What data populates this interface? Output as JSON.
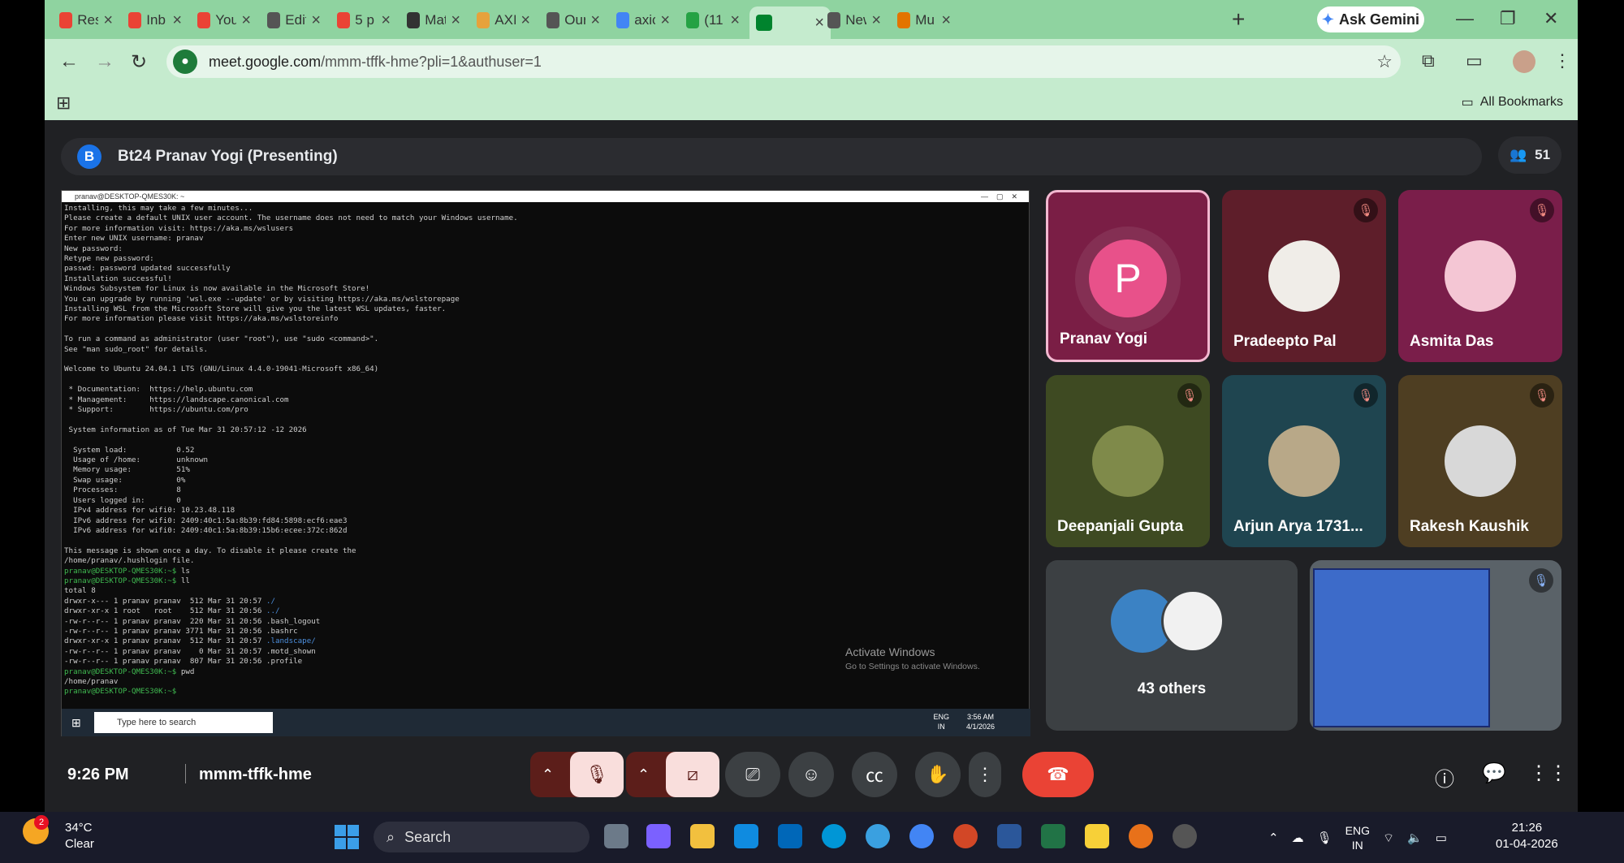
{
  "browser": {
    "tabs": [
      {
        "title": "Res",
        "color": "#ea4335"
      },
      {
        "title": "Inb",
        "color": "#ea4335"
      },
      {
        "title": "You",
        "color": "#ea4335"
      },
      {
        "title": "Edit",
        "color": "#555555"
      },
      {
        "title": "5 p",
        "color": "#ea4335"
      },
      {
        "title": "Mat",
        "color": "#333333"
      },
      {
        "title": "AXI",
        "color": "#e6a23c"
      },
      {
        "title": "Our",
        "color": "#555555"
      },
      {
        "title": "axic",
        "color": "#4285f4"
      },
      {
        "title": "(11",
        "color": "#25a244"
      },
      {
        "title": "",
        "color": "#00832d"
      },
      {
        "title": "New",
        "color": "#555555"
      },
      {
        "title": "Mu",
        "color": "#e37400"
      }
    ],
    "gemini_label": "Ask Gemini",
    "url_host": "meet.google.com",
    "url_path": "/mmm-tffk-hme?pli=1&authuser=1",
    "all_bookmarks": "All Bookmarks"
  },
  "meet": {
    "presenter_initial": "B",
    "presenter_label": "Bt24 Pranav Yogi (Presenting)",
    "participant_count": "51",
    "time": "9:26 PM",
    "meeting_code": "mmm-tffk-hme",
    "tiles": [
      {
        "name": "Pranav Yogi",
        "initial": "P",
        "muted": false
      },
      {
        "name": "Pradeepto Pal",
        "muted": true
      },
      {
        "name": "Asmita Das",
        "muted": true
      },
      {
        "name": "Deepanjali Gupta",
        "muted": true
      },
      {
        "name": "Arjun Arya 1731...",
        "muted": true
      },
      {
        "name": "Rakesh Kaushik",
        "muted": true
      }
    ],
    "others_label": "43 others"
  },
  "shared_screen": {
    "window_title": "pranav@DESKTOP-QMES30K: ~",
    "lines": [
      "Installing, this may take a few minutes...",
      "Please create a default UNIX user account. The username does not need to match your Windows username.",
      "For more information visit: https://aka.ms/wslusers",
      "Enter new UNIX username: pranav",
      "New password:",
      "Retype new password:",
      "passwd: password updated successfully",
      "Installation successful!",
      "Windows Subsystem for Linux is now available in the Microsoft Store!",
      "You can upgrade by running 'wsl.exe --update' or by visiting https://aka.ms/wslstorepage",
      "Installing WSL from the Microsoft Store will give you the latest WSL updates, faster.",
      "For more information please visit https://aka.ms/wslstoreinfo",
      "",
      "To run a command as administrator (user \"root\"), use \"sudo <command>\".",
      "See \"man sudo_root\" for details.",
      "",
      "Welcome to Ubuntu 24.04.1 LTS (GNU/Linux 4.4.0-19041-Microsoft x86_64)",
      "",
      " * Documentation:  https://help.ubuntu.com",
      " * Management:     https://landscape.canonical.com",
      " * Support:        https://ubuntu.com/pro",
      "",
      " System information as of Tue Mar 31 20:57:12 -12 2026",
      "",
      "  System load:           0.52",
      "  Usage of /home:        unknown",
      "  Memory usage:          51%",
      "  Swap usage:            0%",
      "  Processes:             8",
      "  Users logged in:       0",
      "  IPv4 address for wifi0: 10.23.48.118",
      "  IPv6 address for wifi0: 2409:40c1:5a:8b39:fd84:5898:ecf6:eae3",
      "  IPv6 address for wifi0: 2409:40c1:5a:8b39:15b6:ecee:372c:862d",
      "",
      "This message is shown once a day. To disable it please create the",
      "/home/pranav/.hushlogin file."
    ],
    "prompt": "pranav@DESKTOP-QMES30K:~$",
    "cmd_ls": " ls",
    "cmd_ll": " ll",
    "total": "total 8",
    "listing": [
      {
        "row": "drwxr-x--- 1 pranav pranav  512 Mar 31 20:57 ",
        "name": "./"
      },
      {
        "row": "drwxr-xr-x 1 root   root    512 Mar 31 20:56 ",
        "name": "../"
      },
      {
        "row": "-rw-r--r-- 1 pranav pranav  220 Mar 31 20:56 ",
        "name": ".bash_logout"
      },
      {
        "row": "-rw-r--r-- 1 pranav pranav 3771 Mar 31 20:56 ",
        "name": ".bashrc"
      },
      {
        "row": "drwxr-xr-x 1 pranav pranav  512 Mar 31 20:57 ",
        "name": ".landscape/"
      },
      {
        "row": "-rw-r--r-- 1 pranav pranav    0 Mar 31 20:57 ",
        "name": ".motd_shown"
      },
      {
        "row": "-rw-r--r-- 1 pranav pranav  807 Mar 31 20:56 ",
        "name": ".profile"
      }
    ],
    "cmd_pwd": " pwd",
    "pwd_out": "/home/pranav",
    "activate_title": "Activate Windows",
    "activate_sub": "Go to Settings to activate Windows.",
    "win_search": "Type here to search",
    "win_lang1": "ENG",
    "win_lang2": "IN",
    "win_time": "3:56 AM",
    "win_date": "4/1/2026"
  },
  "taskbar": {
    "temp": "34°C",
    "weather": "Clear",
    "weather_badge": "2",
    "search": "Search",
    "lang1": "ENG",
    "lang2": "IN",
    "time": "21:26",
    "date": "01-04-2026"
  }
}
